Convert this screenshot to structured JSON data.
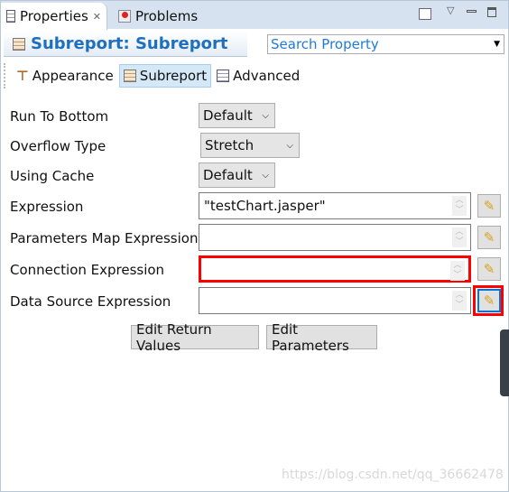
{
  "tabs": [
    {
      "label": "Properties",
      "active": true
    },
    {
      "label": "Problems",
      "active": false
    }
  ],
  "header": {
    "title": "Subreport: Subreport",
    "search_placeholder": "Search Property"
  },
  "section_tabs": [
    {
      "label": "Appearance"
    },
    {
      "label": "Subreport",
      "selected": true
    },
    {
      "label": "Advanced"
    }
  ],
  "fields": {
    "run_to_bottom": {
      "label": "Run To Bottom",
      "value": "Default"
    },
    "overflow_type": {
      "label": "Overflow Type",
      "value": "Stretch"
    },
    "using_cache": {
      "label": "Using Cache",
      "value": "Default"
    },
    "expression": {
      "label": "Expression",
      "value": "\"testChart.jasper\""
    },
    "parameters_map": {
      "label": "Parameters Map Expression",
      "value": ""
    },
    "connection": {
      "label": "Connection Expression",
      "value": ""
    },
    "data_source": {
      "label": "Data Source Expression",
      "value": ""
    }
  },
  "buttons": {
    "edit_return_values": "Edit Return Values",
    "edit_parameters": "Edit Parameters"
  },
  "watermark": "https://blog.csdn.net/qq_36662478",
  "colors": {
    "accent": "#1f6fbf",
    "highlight": "#ff0000"
  }
}
